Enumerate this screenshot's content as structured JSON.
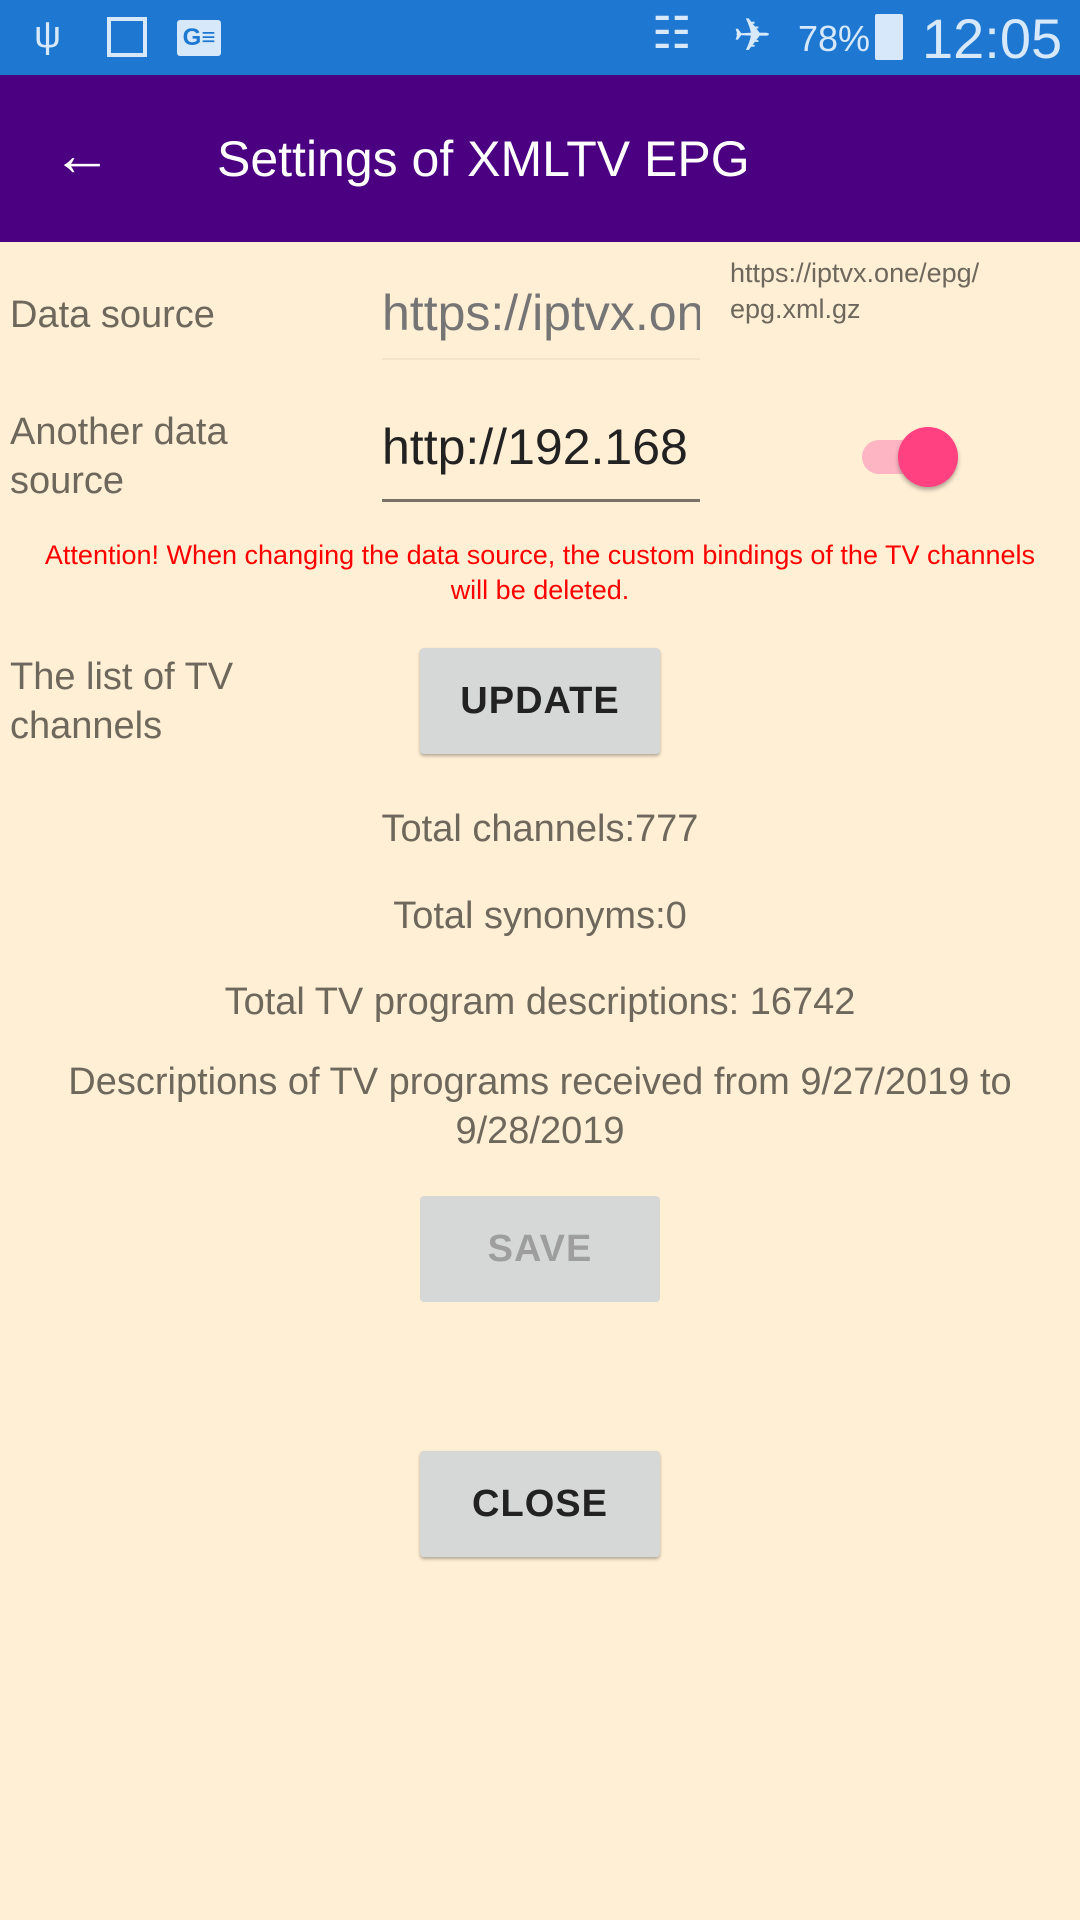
{
  "status_bar": {
    "icons": [
      "usb-icon",
      "image-icon",
      "news-icon",
      "wifi-icon",
      "airplane-icon",
      "battery-charging-icon"
    ],
    "battery": "78%",
    "time": "12:05"
  },
  "app_bar": {
    "title": "Settings of XMLTV EPG",
    "back_icon": "arrow-left-icon"
  },
  "data_source": {
    "label": "Data source",
    "placeholder": "https://iptvx.one/epg/epg.xml.gz",
    "hint": "https://iptvx.one/epg/\nepg.xml.gz"
  },
  "another_source": {
    "label": "Another data source",
    "value": "http://192.168",
    "toggle_on": true
  },
  "warning": "Attention! When changing the data source, the custom bindings of the TV channels will be deleted.",
  "channels_list": {
    "label": "The list of TV channels",
    "update_label": "UPDATE"
  },
  "stats": {
    "channels": "Total channels:777",
    "synonyms": "Total synonyms:0",
    "descriptions": "Total TV program descriptions: 16742",
    "range": "Descriptions of TV programs received from 9/27/2019 to 9/28/2019"
  },
  "save_label": "SAVE",
  "close_label": "CLOSE",
  "colors": {
    "status_bar": "#1E78D2",
    "app_bar": "#4B0082",
    "background": "#FFEFD5",
    "warning": "#FF0000",
    "toggle": "#FF4081"
  }
}
